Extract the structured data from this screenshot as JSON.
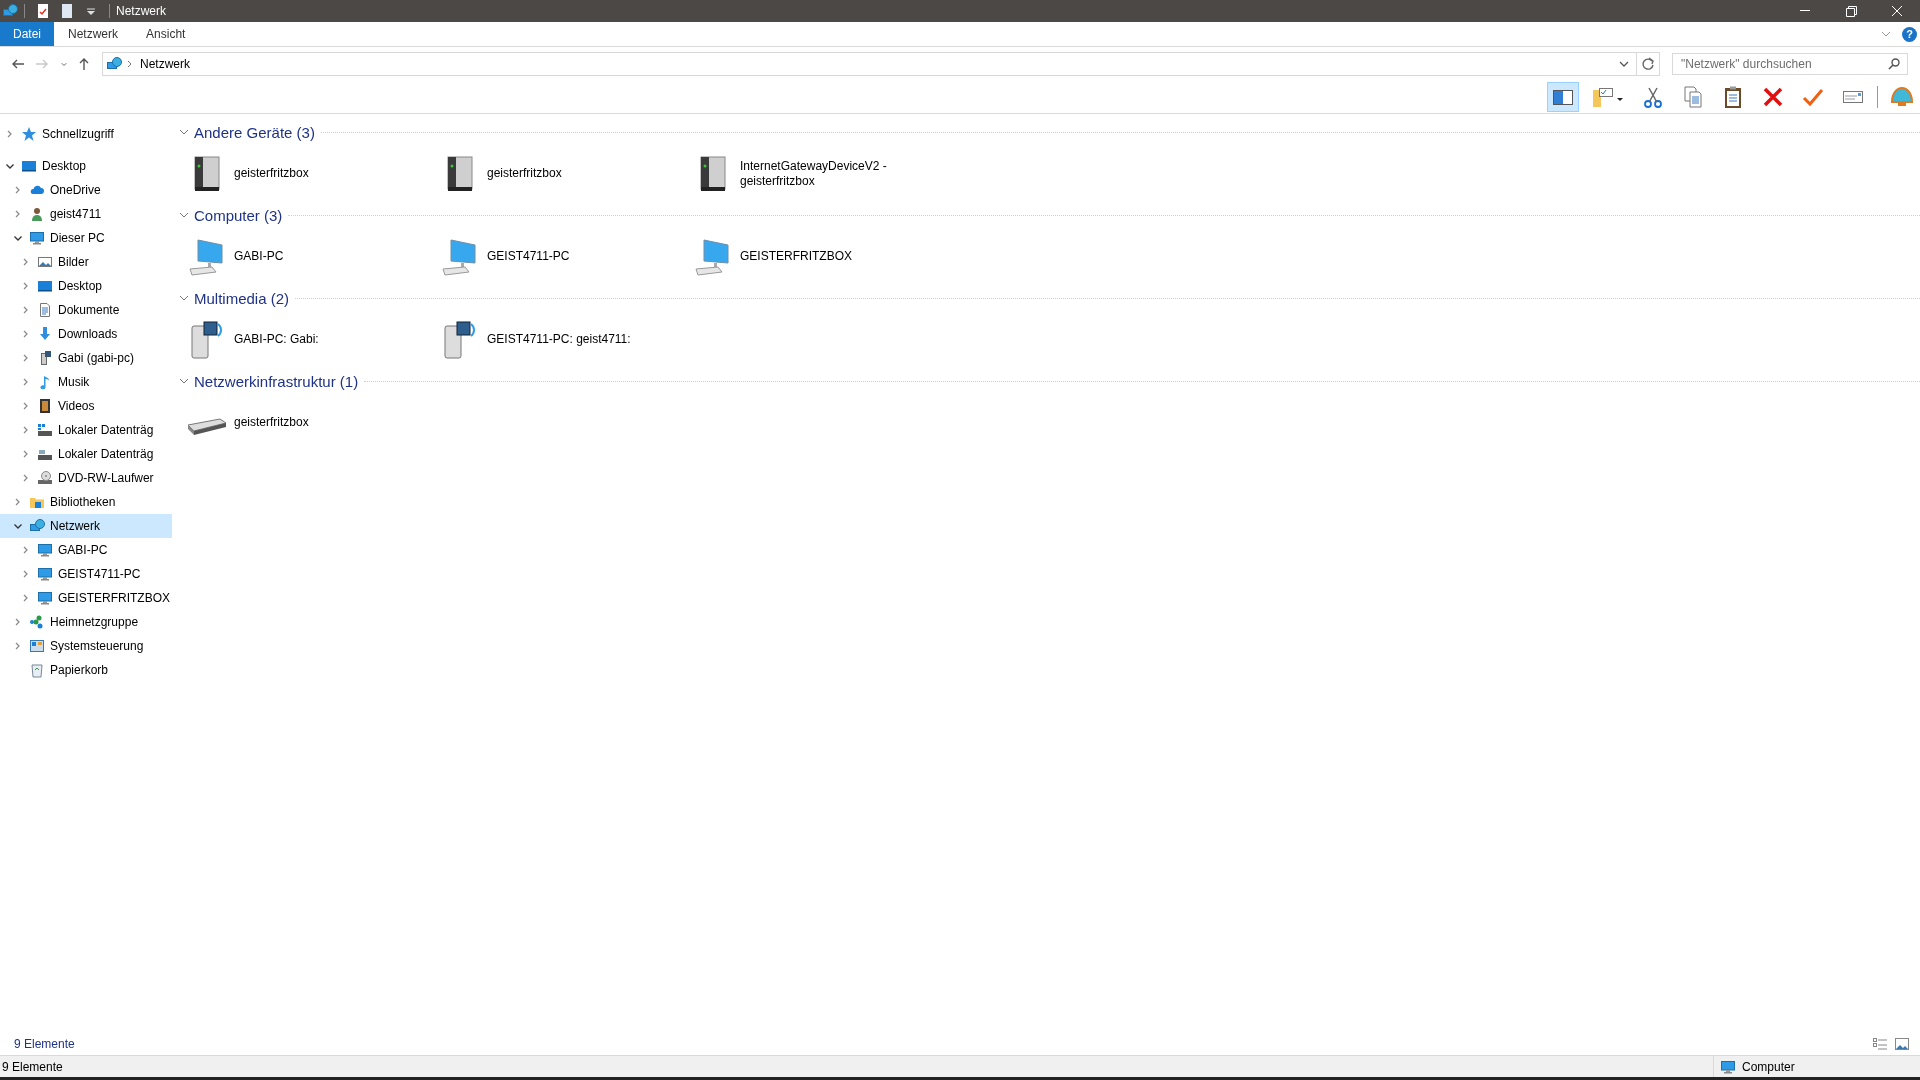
{
  "window": {
    "title": "Netzwerk",
    "quick_access": [
      {
        "kind": "properties"
      },
      {
        "kind": "new-folder"
      },
      {
        "kind": "customize"
      }
    ]
  },
  "ribbon": {
    "tabs": [
      {
        "label": "Datei",
        "kind": "file"
      },
      {
        "label": "Netzwerk",
        "kind": "tab"
      },
      {
        "label": "Ansicht",
        "kind": "tab"
      }
    ],
    "help": "?"
  },
  "navigation": {
    "buttons": [
      {
        "kind": "back",
        "disabled": false
      },
      {
        "kind": "forward",
        "disabled": true
      },
      {
        "kind": "recent",
        "disabled": false
      },
      {
        "kind": "up",
        "disabled": false
      }
    ],
    "address": "Netzwerk",
    "search": {
      "placeholder": "\"Netzwerk\" durchsuchen"
    }
  },
  "toolbar": {
    "preview_pane_on": true,
    "buttons": [
      {
        "kind": "preview-pane"
      },
      {
        "kind": "folder-options"
      },
      {
        "kind": "cut"
      },
      {
        "kind": "copy"
      },
      {
        "kind": "paste"
      },
      {
        "kind": "delete"
      },
      {
        "kind": "check"
      },
      {
        "kind": "card"
      },
      {
        "kind": "shell"
      }
    ]
  },
  "sidebar": {
    "items": [
      {
        "label": "Schnellzugriff",
        "kind": "star",
        "expandable": true,
        "expanded": false,
        "selected": false
      },
      {
        "label": "Desktop",
        "kind": "desktop",
        "expandable": true,
        "expanded": true,
        "selected": false,
        "children": [
          {
            "label": "OneDrive",
            "kind": "cloud",
            "expandable": true,
            "expanded": false,
            "selected": false
          },
          {
            "label": "geist4711",
            "kind": "user",
            "expandable": true,
            "expanded": false,
            "selected": false
          },
          {
            "label": "Dieser PC",
            "kind": "monitor",
            "expandable": true,
            "expanded": true,
            "selected": false,
            "children": [
              {
                "label": "Bilder",
                "kind": "pictures",
                "expandable": true,
                "expanded": false,
                "selected": false
              },
              {
                "label": "Desktop",
                "kind": "desktop",
                "expandable": true,
                "expanded": false,
                "selected": false
              },
              {
                "label": "Dokumente",
                "kind": "documents",
                "expandable": true,
                "expanded": false,
                "selected": false
              },
              {
                "label": "Downloads",
                "kind": "downloads",
                "expandable": true,
                "expanded": false,
                "selected": false
              },
              {
                "label": "Gabi (gabi-pc)",
                "kind": "media-share",
                "expandable": true,
                "expanded": false,
                "selected": false
              },
              {
                "label": "Musik",
                "kind": "music",
                "expandable": true,
                "expanded": false,
                "selected": false
              },
              {
                "label": "Videos",
                "kind": "videos",
                "expandable": true,
                "expanded": false,
                "selected": false
              },
              {
                "label": "Lokaler Datenträg",
                "kind": "drive-win",
                "expandable": true,
                "expanded": false,
                "selected": false
              },
              {
                "label": "Lokaler Datenträg",
                "kind": "drive",
                "expandable": true,
                "expanded": false,
                "selected": false
              },
              {
                "label": "DVD-RW-Laufwer",
                "kind": "dvd",
                "expandable": true,
                "expanded": false,
                "selected": false
              }
            ]
          },
          {
            "label": "Bibliotheken",
            "kind": "libraries",
            "expandable": true,
            "expanded": false,
            "selected": false
          },
          {
            "label": "Netzwerk",
            "kind": "network",
            "expandable": true,
            "expanded": true,
            "selected": true,
            "children": [
              {
                "label": "GABI-PC",
                "kind": "monitor",
                "expandable": true,
                "expanded": false,
                "selected": false
              },
              {
                "label": "GEIST4711-PC",
                "kind": "monitor",
                "expandable": true,
                "expanded": false,
                "selected": false
              },
              {
                "label": "GEISTERFRITZBOX",
                "kind": "monitor",
                "expandable": true,
                "expanded": false,
                "selected": false
              }
            ]
          },
          {
            "label": "Heimnetzgruppe",
            "kind": "homegroup",
            "expandable": true,
            "expanded": false,
            "selected": false
          },
          {
            "label": "Systemsteuerung",
            "kind": "control-panel",
            "expandable": true,
            "expanded": false,
            "selected": false
          },
          {
            "label": "Papierkorb",
            "kind": "recycle-bin",
            "expandable": false,
            "selected": false
          }
        ]
      }
    ]
  },
  "groups": [
    {
      "title": "Andere Geräte (3)",
      "expanded": true,
      "items": [
        {
          "name": "geisterfritzbox",
          "kind": "server"
        },
        {
          "name": "geisterfritzbox",
          "kind": "server"
        },
        {
          "name": "InternetGatewayDeviceV2 - geisterfritzbox",
          "kind": "server"
        }
      ]
    },
    {
      "title": "Computer (3)",
      "expanded": true,
      "items": [
        {
          "name": "GABI-PC",
          "kind": "computer"
        },
        {
          "name": "GEIST4711-PC",
          "kind": "computer"
        },
        {
          "name": "GEISTERFRITZBOX",
          "kind": "computer"
        }
      ]
    },
    {
      "title": "Multimedia (2)",
      "expanded": true,
      "items": [
        {
          "name": "GABI-PC: Gabi:",
          "kind": "media"
        },
        {
          "name": "GEIST4711-PC: geist4711:",
          "kind": "media"
        }
      ]
    },
    {
      "title": "Netzwerkinfrastruktur (1)",
      "expanded": true,
      "items": [
        {
          "name": "geisterfritzbox",
          "kind": "router"
        }
      ]
    }
  ],
  "content_footer": {
    "count": "9 Elemente",
    "views": [
      {
        "kind": "details",
        "selected": false
      },
      {
        "kind": "large-icons",
        "selected": false
      }
    ]
  },
  "status_bar": {
    "count": "9 Elemente",
    "zone": "Computer"
  }
}
